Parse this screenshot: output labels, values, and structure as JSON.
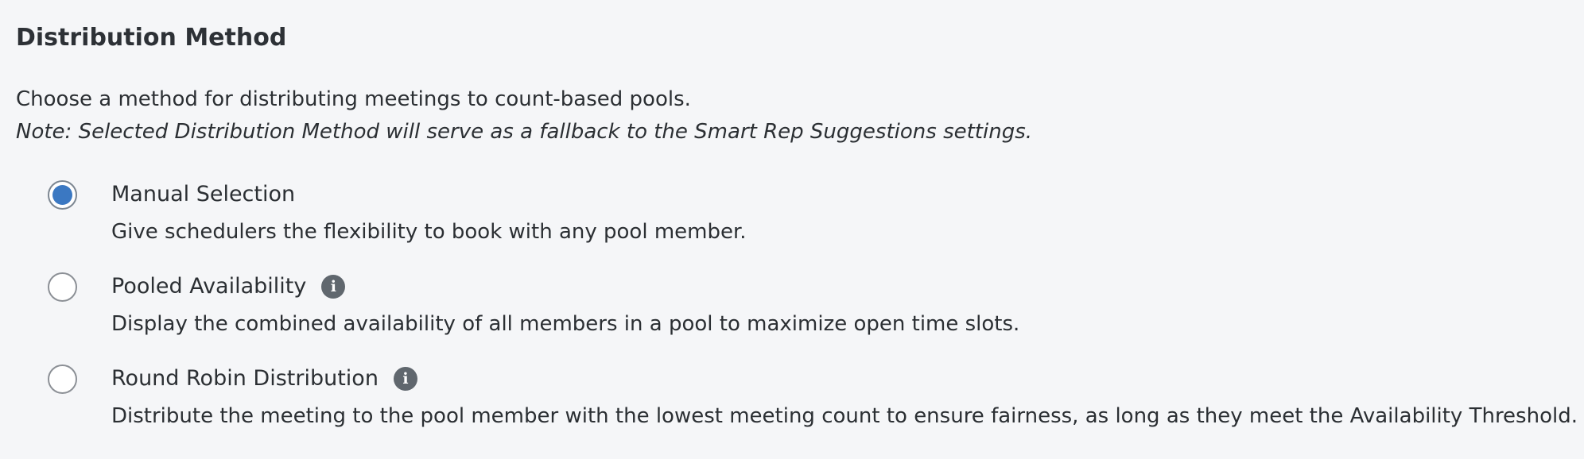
{
  "section": {
    "title": "Distribution Method",
    "description": "Choose a method for distributing meetings to count-based pools.",
    "note": "Note: Selected Distribution Method will serve as a fallback to the Smart Rep Suggestions settings."
  },
  "options": [
    {
      "label": "Manual Selection",
      "description": "Give schedulers the flexibility to book with any pool member.",
      "selected": true,
      "has_info_icon": false
    },
    {
      "label": "Pooled Availability",
      "description": "Display the combined availability of all members in a pool to maximize open time slots.",
      "selected": false,
      "has_info_icon": true,
      "info_icon": "info-icon"
    },
    {
      "label": "Round Robin Distribution",
      "description": "Distribute the meeting to the pool member with the lowest meeting count to ensure fairness, as long as they meet the Availability Threshold.",
      "selected": false,
      "has_info_icon": true,
      "info_icon": "info-icon"
    }
  ],
  "icons": {
    "info_glyph": "i"
  },
  "colors": {
    "background": "#f5f6f8",
    "radio_selected": "#3b78c2",
    "info_icon_bg": "#60676e",
    "text": "#2b2f33"
  }
}
